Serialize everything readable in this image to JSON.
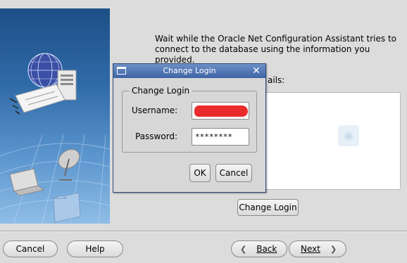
{
  "main": {
    "info_text": "Wait while the Oracle Net Configuration Assistant tries to connect to the database using the information you provided.",
    "details_label": "ails:",
    "change_login_button": "Change Login"
  },
  "footer": {
    "cancel_label": "Cancel",
    "help_label": "Help",
    "back_label": "Back",
    "next_label": "Next"
  },
  "dialog": {
    "title": "Change Login",
    "group_title": "Change Login",
    "username_label": "Username:",
    "username_value": "",
    "password_label": "Password:",
    "password_value": "********",
    "ok_label": "OK",
    "cancel_label": "Cancel"
  },
  "icons": {
    "window": "window-icon",
    "close": "close-icon",
    "back": "back-arrow-icon",
    "next": "next-arrow-icon"
  },
  "colors": {
    "titlebar": "#3d64a6",
    "redaction": "#ea2b2b",
    "panel": "#2f6aa8"
  }
}
